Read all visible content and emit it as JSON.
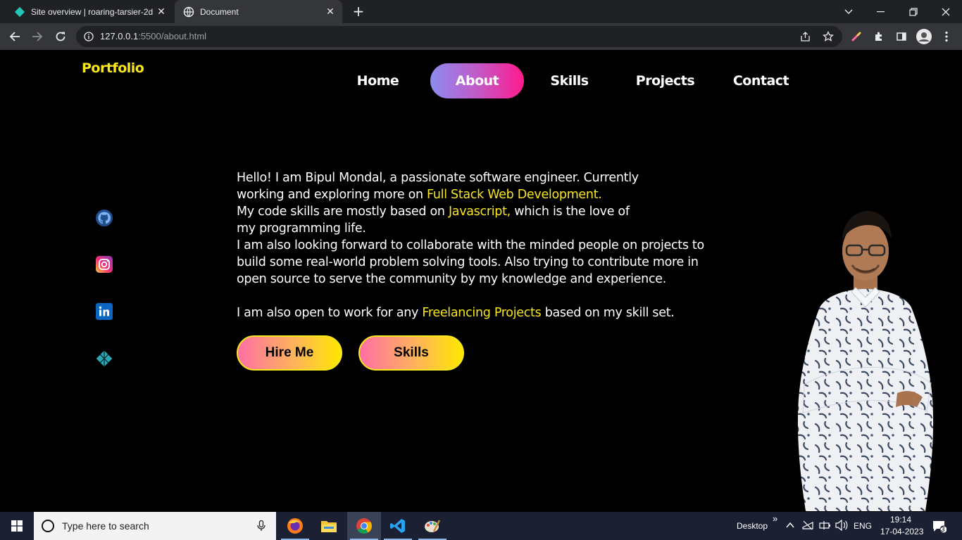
{
  "browser": {
    "tabs": [
      {
        "title": "Site overview | roaring-tarsier-2d",
        "active": false
      },
      {
        "title": "Document",
        "active": true
      }
    ],
    "url_host": "127.0.0.1",
    "url_rest": ":5500/about.html"
  },
  "page": {
    "logo": "Portfolio",
    "nav": [
      "Home",
      "About",
      "Skills",
      "Projects",
      "Contact"
    ],
    "active_nav": "About",
    "about": {
      "line1": "Hello! I am Bipul Mondal, a passionate software engineer. Currently",
      "line2_pre": "working and exploring more on ",
      "line2_hl": "Full Stack Web Development.",
      "line3_pre": "My code skills are mostly based on ",
      "line3_hl": "Javascript,",
      "line3_post": " which is the love of",
      "line4": "my programming life.",
      "line5": "I am also looking forward to collaborate with the minded people on projects to",
      "line6": "build some real-world problem solving tools. Also trying to contribute more in",
      "line7": "open source to serve the community by my knowledge and experience.",
      "line8_pre": "I am also open to work for any ",
      "line8_hl": "Freelancing Projects",
      "line8_post": " based on my skill set."
    },
    "buttons": {
      "hire": "Hire Me",
      "skills": "Skills"
    },
    "social": [
      "github-icon",
      "instagram-icon",
      "linkedin-icon",
      "netlify-icon"
    ],
    "highlight_color": "#f8e71c"
  },
  "taskbar": {
    "search_placeholder": "Type here to search",
    "desktop_label": "Desktop",
    "lang": "ENG",
    "time": "19:14",
    "date": "17-04-2023",
    "notifications": "3"
  }
}
